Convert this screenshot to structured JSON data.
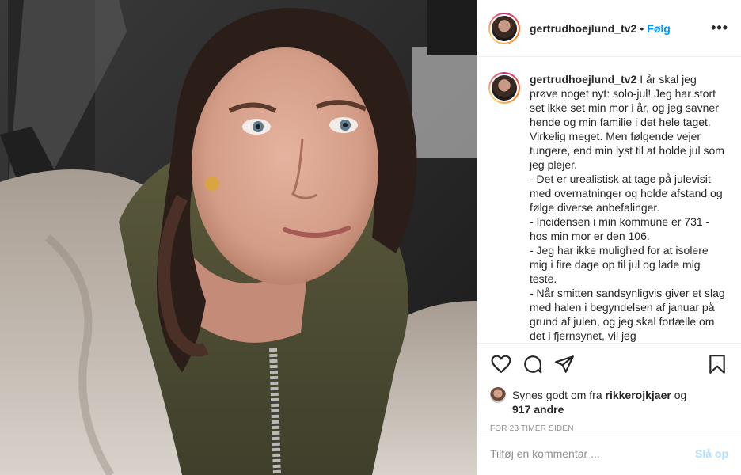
{
  "post": {
    "username": "gertrudhoejlund_tv2",
    "follow_label": "Følg",
    "separator": "•",
    "more_label": "•••",
    "caption": " I år skal jeg prøve noget nyt: solo-jul! Jeg har stort set ikke set min mor i år, og jeg savner hende og min familie i det hele taget. Virkelig meget. Men følgende vejer tungere, end min lyst til at holde jul som jeg plejer.\n- Det er urealistisk at tage på julevisit med overnatninger og holde afstand og følge diverse anbefalinger.\n- Incidensen i min kommune er 731 - hos min mor er den 106.\n- Jeg har ikke mulighed for at isolere mig i fire dage op til jul og lade mig teste.\n- Når smitten sandsynligvis giver et slag med halen i begyndelsen af januar på grund af julen, og jeg skal fortælle om det i fjernsynet, vil jeg",
    "likes_prefix": "Synes godt om fra ",
    "likes_user": "rikkerojkjaer",
    "likes_and": " og",
    "likes_count": "917 andre",
    "timestamp": "FOR 23 TIMER SIDEN",
    "comment_placeholder": "Tilføj en kommentar ...",
    "post_label": "Slå op"
  },
  "icons": {
    "like": "heart-icon",
    "comment": "comment-icon",
    "share": "paper-plane-icon",
    "save": "bookmark-icon"
  },
  "colors": {
    "follow": "#0095f6",
    "post_disabled": "#b2dffc",
    "muted": "#8e8e8e",
    "border": "#efefef"
  }
}
